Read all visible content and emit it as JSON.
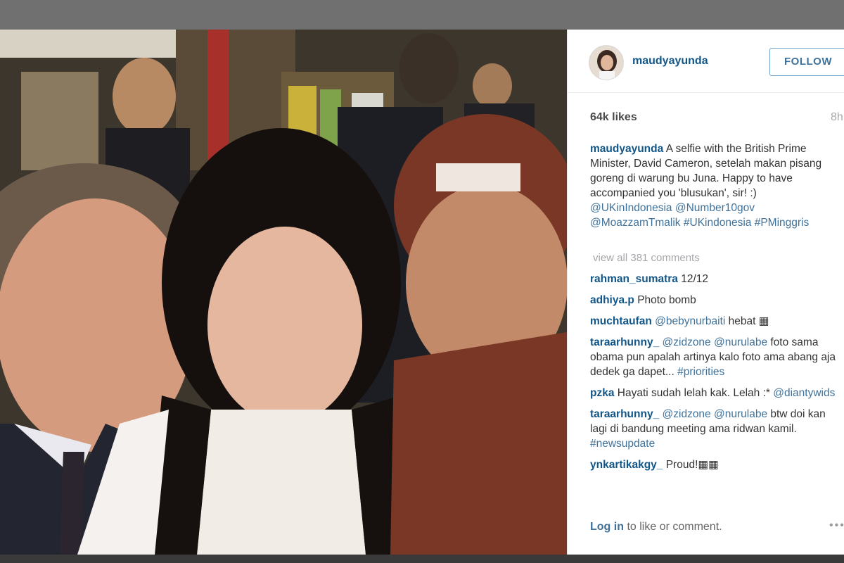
{
  "post": {
    "username": "maudyayunda",
    "follow_label": "FOLLOW",
    "likes": "64k likes",
    "time": "8h",
    "caption": {
      "username": "maudyayunda",
      "text": "A selfie with the British Prime Minister, David Cameron, setelah makan pisang goreng di warung bu Juna. Happy to have accompanied you 'blusukan', sir! :)",
      "tags": [
        "@UKinIndonesia",
        "@Number10gov",
        "@MoazzamTmalik",
        "#UKindonesia",
        "#PMinggris"
      ]
    },
    "view_all": "view all 381 comments",
    "comments": [
      {
        "user": "rahman_sumatra",
        "parts": [
          {
            "t": "12/12"
          }
        ]
      },
      {
        "user": "adhiya.p",
        "parts": [
          {
            "t": "Photo bomb"
          }
        ]
      },
      {
        "user": "muchtaufan",
        "parts": [
          {
            "t": "@bebynurbaiti",
            "tag": true
          },
          {
            "t": "hebat ▦"
          }
        ]
      },
      {
        "user": "taraarhunny_",
        "parts": [
          {
            "t": "@zidzone",
            "tag": true
          },
          {
            "t": "@nurulabe",
            "tag": true
          },
          {
            "t": "foto sama obama pun apalah artinya kalo foto ama abang aja dedek ga dapet..."
          },
          {
            "t": "#priorities",
            "tag": true
          }
        ]
      },
      {
        "user": "pzka",
        "parts": [
          {
            "t": "Hayati sudah lelah kak. Lelah :*"
          },
          {
            "t": "@diantywids",
            "tag": true
          }
        ]
      },
      {
        "user": "taraarhunny_",
        "parts": [
          {
            "t": "@zidzone",
            "tag": true
          },
          {
            "t": "@nurulabe",
            "tag": true
          },
          {
            "t": "btw doi kan lagi di bandung meeting ama ridwan kamil."
          },
          {
            "t": "#newsupdate",
            "tag": true
          }
        ]
      },
      {
        "user": "ynkartikakgy_",
        "parts": [
          {
            "t": "Proud!▦▦"
          }
        ]
      }
    ],
    "login_link": "Log in",
    "login_text": "to like or comment.",
    "more": "•••"
  },
  "colors": {
    "username": "#125688",
    "tag": "#3f729b",
    "follow_border": "#70a4cc",
    "muted": "#a5a7aa"
  },
  "icons": [
    "avatar-icon",
    "more-options-icon"
  ]
}
